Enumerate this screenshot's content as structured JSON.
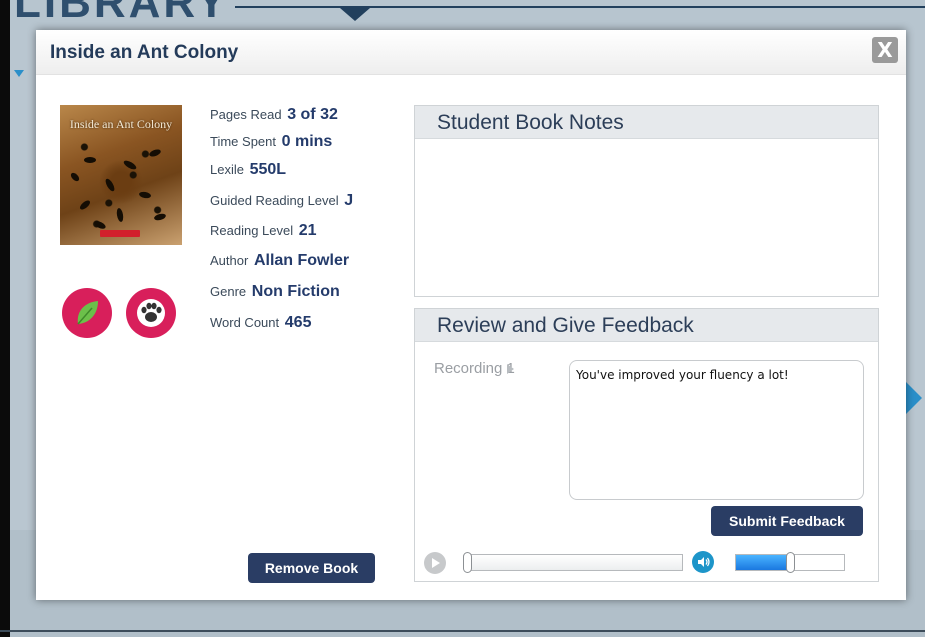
{
  "background": {
    "title": "LIBRARY"
  },
  "modal": {
    "title": "Inside an Ant Colony",
    "close_label": "X"
  },
  "book": {
    "cover_title": "Inside an Ant Colony",
    "cover_icon": "book-cover-image",
    "badges": [
      "leaf-icon",
      "paw-icon"
    ]
  },
  "stats": [
    {
      "label": "Pages Read",
      "value": "3 of 32"
    },
    {
      "label": "Time Spent",
      "value": "0 mins"
    },
    {
      "label": "Lexile",
      "value": "550L"
    },
    {
      "label": "Guided Reading Level",
      "value": "J"
    },
    {
      "label": "Reading Level",
      "value": "21"
    },
    {
      "label": "Author",
      "value": "Allan Fowler"
    },
    {
      "label": "Genre",
      "value": "Non Fiction"
    },
    {
      "label": "Word Count",
      "value": "465"
    }
  ],
  "actions": {
    "remove_book": "Remove Book",
    "submit_feedback": "Submit Feedback"
  },
  "notes_panel": {
    "title": "Student Book Notes"
  },
  "feedback_panel": {
    "title": "Review and Give Feedback",
    "recording_label": "Recording 1",
    "feedback_text": "You've improved your fluency a lot!"
  },
  "player": {
    "progress": 0,
    "volume": 0.5
  },
  "colors": {
    "accent_navy": "#2a3d64",
    "badge_pink": "#d81f5b",
    "volume_blue": "#1d95c9"
  }
}
